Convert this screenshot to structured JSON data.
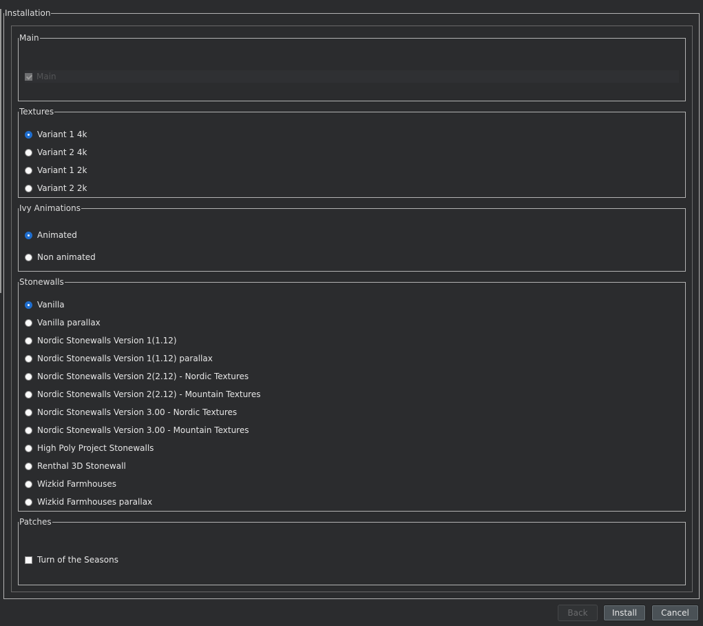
{
  "installation": {
    "title": "Installation",
    "groups": {
      "main": {
        "title": "Main",
        "items": [
          {
            "label": "Main",
            "type": "checkbox",
            "checked": true,
            "disabled": true
          }
        ]
      },
      "textures": {
        "title": "Textures",
        "items": [
          {
            "label": "Variant 1 4k",
            "type": "radio",
            "checked": true
          },
          {
            "label": "Variant 2 4k",
            "type": "radio",
            "checked": false
          },
          {
            "label": "Variant 1 2k",
            "type": "radio",
            "checked": false
          },
          {
            "label": "Variant 2 2k",
            "type": "radio",
            "checked": false
          }
        ]
      },
      "ivy": {
        "title": "Ivy Animations",
        "items": [
          {
            "label": "Animated",
            "type": "radio",
            "checked": true
          },
          {
            "label": "Non animated",
            "type": "radio",
            "checked": false
          }
        ]
      },
      "stonewalls": {
        "title": "Stonewalls",
        "items": [
          {
            "label": "Vanilla",
            "type": "radio",
            "checked": true
          },
          {
            "label": "Vanilla parallax",
            "type": "radio",
            "checked": false
          },
          {
            "label": "Nordic Stonewalls Version 1(1.12)",
            "type": "radio",
            "checked": false
          },
          {
            "label": "Nordic Stonewalls Version 1(1.12) parallax",
            "type": "radio",
            "checked": false
          },
          {
            "label": "Nordic Stonewalls Version 2(2.12) - Nordic Textures",
            "type": "radio",
            "checked": false
          },
          {
            "label": "Nordic Stonewalls Version 2(2.12) - Mountain Textures",
            "type": "radio",
            "checked": false
          },
          {
            "label": "Nordic Stonewalls Version 3.00 - Nordic Textures",
            "type": "radio",
            "checked": false
          },
          {
            "label": "Nordic Stonewalls Version 3.00 - Mountain Textures",
            "type": "radio",
            "checked": false
          },
          {
            "label": "High Poly Project Stonewalls",
            "type": "radio",
            "checked": false
          },
          {
            "label": "Renthal 3D Stonewall",
            "type": "radio",
            "checked": false
          },
          {
            "label": "Wizkid Farmhouses",
            "type": "radio",
            "checked": false
          },
          {
            "label": "Wizkid Farmhouses parallax",
            "type": "radio",
            "checked": false
          }
        ]
      },
      "patches": {
        "title": "Patches",
        "items": [
          {
            "label": "Turn of the Seasons",
            "type": "checkbox",
            "checked": false
          }
        ]
      }
    }
  },
  "buttons": {
    "back": "Back",
    "install": "Install",
    "cancel": "Cancel"
  },
  "colors": {
    "background": "#2b2c2e",
    "accent": "#1f6ecf",
    "border": "#b4b4b4"
  }
}
